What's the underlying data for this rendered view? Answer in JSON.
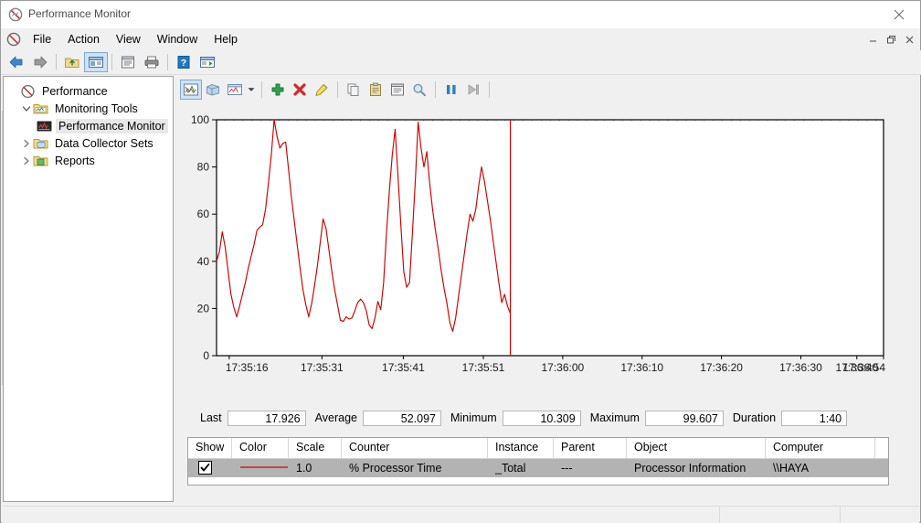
{
  "window": {
    "title": "Performance Monitor",
    "app_icon": "perfmon-icon",
    "minimize_label": "Minimize",
    "maximize_label": "Maximize",
    "close_label": "Close"
  },
  "menubar": {
    "icon": "perfmon-icon",
    "items": [
      {
        "label": "File"
      },
      {
        "label": "Action"
      },
      {
        "label": "View"
      },
      {
        "label": "Window"
      },
      {
        "label": "Help"
      }
    ],
    "mdi_buttons": [
      {
        "name": "mdi-minimize",
        "glyph": "–"
      },
      {
        "name": "mdi-restore",
        "glyph": "❐"
      },
      {
        "name": "mdi-close",
        "glyph": "✕"
      }
    ]
  },
  "toolbar": {
    "buttons": [
      {
        "name": "back-icon",
        "tooltip": "Back"
      },
      {
        "name": "forward-icon",
        "tooltip": "Forward"
      },
      {
        "name": "up-folder-icon",
        "tooltip": "Up One Level"
      },
      {
        "name": "show-hide-console-tree-icon",
        "tooltip": "Show/Hide Console Tree",
        "selected": true
      },
      {
        "name": "properties-icon",
        "tooltip": "Properties"
      },
      {
        "name": "print-icon",
        "tooltip": "Print"
      },
      {
        "name": "help-icon",
        "tooltip": "Help"
      },
      {
        "name": "show-hide-action-pane-icon",
        "tooltip": "Show/Hide Action Pane"
      }
    ]
  },
  "sidebar": {
    "items": [
      {
        "label": "Performance",
        "icon": "performance-icon",
        "indent": 1,
        "chevron": "none",
        "selected": false
      },
      {
        "label": "Monitoring Tools",
        "icon": "folder-tools-icon",
        "indent": 2,
        "chevron": "expanded",
        "selected": false
      },
      {
        "label": "Performance Monitor",
        "icon": "perf-chart-icon",
        "indent": 3,
        "chevron": "none",
        "selected": true
      },
      {
        "label": "Data Collector Sets",
        "icon": "folder-data-icon",
        "indent": 2,
        "chevron": "collapsed",
        "selected": false
      },
      {
        "label": "Reports",
        "icon": "folder-reports-icon",
        "indent": 2,
        "chevron": "collapsed",
        "selected": false
      }
    ]
  },
  "graph_toolbar": {
    "buttons": [
      {
        "name": "view-line-graph-icon",
        "tooltip": "View Line Graph",
        "selected": true
      },
      {
        "name": "view-histogram-icon",
        "tooltip": "View Histogram"
      },
      {
        "name": "change-graph-type-icon",
        "tooltip": "Change Graph Type"
      },
      {
        "name": "add-counter-icon",
        "tooltip": "Add"
      },
      {
        "name": "delete-counter-icon",
        "tooltip": "Delete"
      },
      {
        "name": "highlight-icon",
        "tooltip": "Highlight"
      },
      {
        "name": "copy-properties-icon",
        "tooltip": "Copy Properties"
      },
      {
        "name": "paste-counter-list-icon",
        "tooltip": "Paste Counter List"
      },
      {
        "name": "properties-icon",
        "tooltip": "Properties"
      },
      {
        "name": "zoom-icon",
        "tooltip": "Zoom To"
      },
      {
        "name": "freeze-display-icon",
        "tooltip": "Freeze Display"
      },
      {
        "name": "update-data-icon",
        "tooltip": "Update Data"
      }
    ],
    "dropdown_caret": "chevron-down-icon"
  },
  "stats": {
    "rows": [
      {
        "label": "Last",
        "value": "17.926"
      },
      {
        "label": "Average",
        "value": "52.097"
      },
      {
        "label": "Minimum",
        "value": "10.309"
      },
      {
        "label": "Maximum",
        "value": "99.607"
      },
      {
        "label": "Duration",
        "value": "1:40"
      }
    ]
  },
  "legend": {
    "columns": [
      "Show",
      "Color",
      "Scale",
      "Counter",
      "Instance",
      "Parent",
      "Object",
      "Computer"
    ],
    "rows": [
      {
        "show": true,
        "color": "#cc0000",
        "scale": "1.0",
        "counter": "% Processor Time",
        "instance": "_Total",
        "parent": "---",
        "object": "Processor Information",
        "computer": "\\\\HAYA"
      }
    ]
  },
  "chart_data": {
    "type": "line",
    "title": "",
    "xlabel": "",
    "ylabel": "",
    "ylim": [
      0,
      100
    ],
    "yticks": [
      0,
      20,
      40,
      60,
      80,
      100
    ],
    "grid": false,
    "legend_position": "bottom-table",
    "line_color": "#cc0000",
    "cursor_color": "#cc0000",
    "cursor_x_fraction": 0.4405,
    "ceiling_band": {
      "from": 100,
      "to": 103,
      "style": "diagonal-hatch"
    },
    "xticks": [
      "17:35:16",
      "17:35:31",
      "17:35:41",
      "17:35:51",
      "17:36:00",
      "17:36:10",
      "17:36:20",
      "17:36:30",
      "17:36:40",
      "17:36:54"
    ],
    "xtick_fractions": [
      0.019,
      0.158,
      0.28,
      0.4,
      0.519,
      0.638,
      0.757,
      0.876,
      0.96,
      1.0
    ],
    "series": [
      {
        "name": "% Processor Time",
        "color": "#cc0000",
        "values": [
          40.0,
          44.0,
          52.5,
          46.0,
          36.0,
          26.0,
          20.5,
          16.5,
          21.0,
          26.0,
          31.0,
          37.0,
          42.0,
          47.0,
          53.0,
          54.5,
          55.5,
          62.0,
          73.0,
          85.0,
          100.0,
          93.0,
          88.0,
          90.0,
          90.5,
          79.0,
          67.0,
          57.0,
          47.0,
          37.0,
          28.0,
          21.5,
          16.5,
          22.0,
          29.5,
          38.0,
          48.0,
          58.0,
          54.0,
          45.0,
          36.0,
          28.0,
          21.5,
          15.0,
          14.5,
          16.5,
          15.5,
          16.0,
          19.0,
          22.5,
          24.0,
          22.5,
          19.0,
          13.0,
          11.5,
          16.0,
          23.0,
          19.5,
          31.0,
          52.0,
          70.0,
          85.0,
          96.0,
          76.0,
          55.0,
          35.5,
          29.0,
          31.0,
          52.0,
          74.0,
          99.0,
          88.0,
          80.0,
          86.5,
          73.0,
          62.0,
          53.0,
          45.0,
          36.0,
          28.5,
          22.0,
          14.0,
          10.3,
          16.0,
          25.0,
          34.0,
          43.0,
          52.0,
          60.0,
          57.0,
          62.0,
          72.0,
          80.0,
          74.0,
          66.0,
          58.0,
          49.0,
          40.0,
          31.0,
          22.5,
          26.0,
          21.0,
          17.926
        ]
      }
    ]
  },
  "statusbar": {
    "text": ""
  }
}
